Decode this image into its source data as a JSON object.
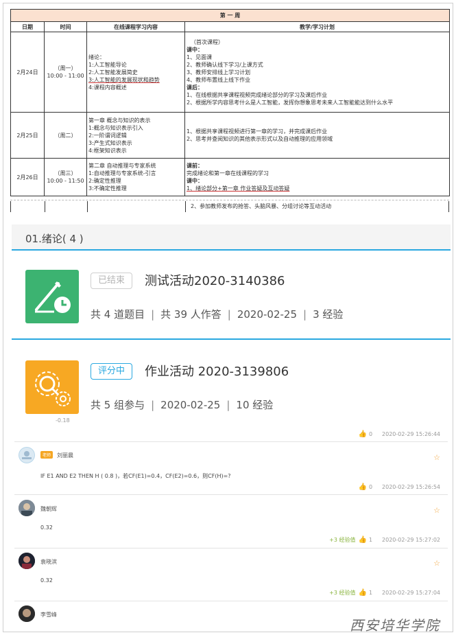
{
  "schedule": {
    "week_title": "第 一 周",
    "headers": [
      "日期",
      "时间",
      "在线课程学习内容",
      "教学/学习计划"
    ],
    "rows": [
      {
        "date": "2月24日",
        "day": "（周一）",
        "time": "10:00 - 11:00",
        "content": [
          "绪论：",
          "1:人工智能导论",
          "2:人工智能发展简史",
          "3:人工智能的发展现状和趋势",
          "4:课程内容概述"
        ],
        "plan": [
          "（首次课程）",
          "课中：",
          "1、见面课",
          "2、教师确认线下学习/上课方式",
          "3、教师安排线上学习计划",
          "4、教师布置线上线下作业",
          "课后：",
          "1、在线根据共享课程视频完成绪论部分的学习及课后作业",
          "2、根据所学内容思考什么是人工智能，发挥你想象思考未来人工智能能达到什么水平"
        ]
      },
      {
        "date": "2月25日",
        "day": "（周二）",
        "time": "",
        "content": [
          "第一章 概念与知识的表示",
          "1:概念与知识表示引入",
          "2:一阶谓词逻辑",
          "3:产生式知识表示",
          "4:框架知识表示"
        ],
        "plan": [
          "1、根据共享课程视频进行第一章的学习，并完成课后作业",
          "2、思考并查阅知识的其他表示形式以及自动推理的应用领域"
        ]
      },
      {
        "date": "2月26日",
        "day": "（周三）",
        "time": "10:00 - 11:50",
        "content": [
          "第二章 自动推理与专家系统",
          "1:自动推理与专家系统-引言",
          "2:确定性推理",
          "3:不确定性推理"
        ],
        "plan": [
          "课前：",
          "完成绪论和第一章在线课程的学习",
          "课中：",
          "1、绪论部分+第一章 作业答疑及互动答疑"
        ]
      }
    ],
    "tail_text": "2、参加教师发布的抢答、头脑风暴、分组讨论等互动活动"
  },
  "course": {
    "section_title": "01.绪论( 4 )",
    "activities": [
      {
        "status": "已结束",
        "name": "测试活动2020-3140386",
        "meta": [
          "共 4 道题目",
          "共 39 人作答",
          "2020-02-25",
          "3 经验"
        ],
        "icon": "test-activity-icon"
      },
      {
        "status": "评分中",
        "name": "作业活动 2020-3139806",
        "meta": [
          "共 5 组参与",
          "2020-02-25",
          "10 经验"
        ],
        "icon": "homework-activity-icon"
      }
    ]
  },
  "comments": {
    "cut_number": "-0.18",
    "top_footer": {
      "likes": "0",
      "time": "2020-02-29 15:26:44"
    },
    "items": [
      {
        "user": "刘丽晨",
        "role": "老师",
        "text": "IF   E1    AND    E2    THEN    H ( 0.8 )，若CF(E1)=0.4，CF(E2)=0.6，则CF(H)=?",
        "xp": "",
        "likes": "0",
        "time": "2020-02-29 15:26:54"
      },
      {
        "user": "魏朝辉",
        "role": "",
        "text": "0.32",
        "xp": "+3 经验值",
        "likes": "1",
        "time": "2020-02-29 15:27:02"
      },
      {
        "user": "袁晓滨",
        "role": "",
        "text": "0.32",
        "xp": "+3 经验值",
        "likes": "1",
        "time": "2020-02-29 15:27:04"
      },
      {
        "user": "李雪峰",
        "role": "",
        "text": "",
        "xp": "",
        "likes": "",
        "time": ""
      }
    ]
  },
  "watermark": "西安培华学院",
  "colors": {
    "accent": "#29a8e0",
    "green": "#3cb371",
    "orange": "#f7a823",
    "week_bg": "#fbe1d0"
  }
}
